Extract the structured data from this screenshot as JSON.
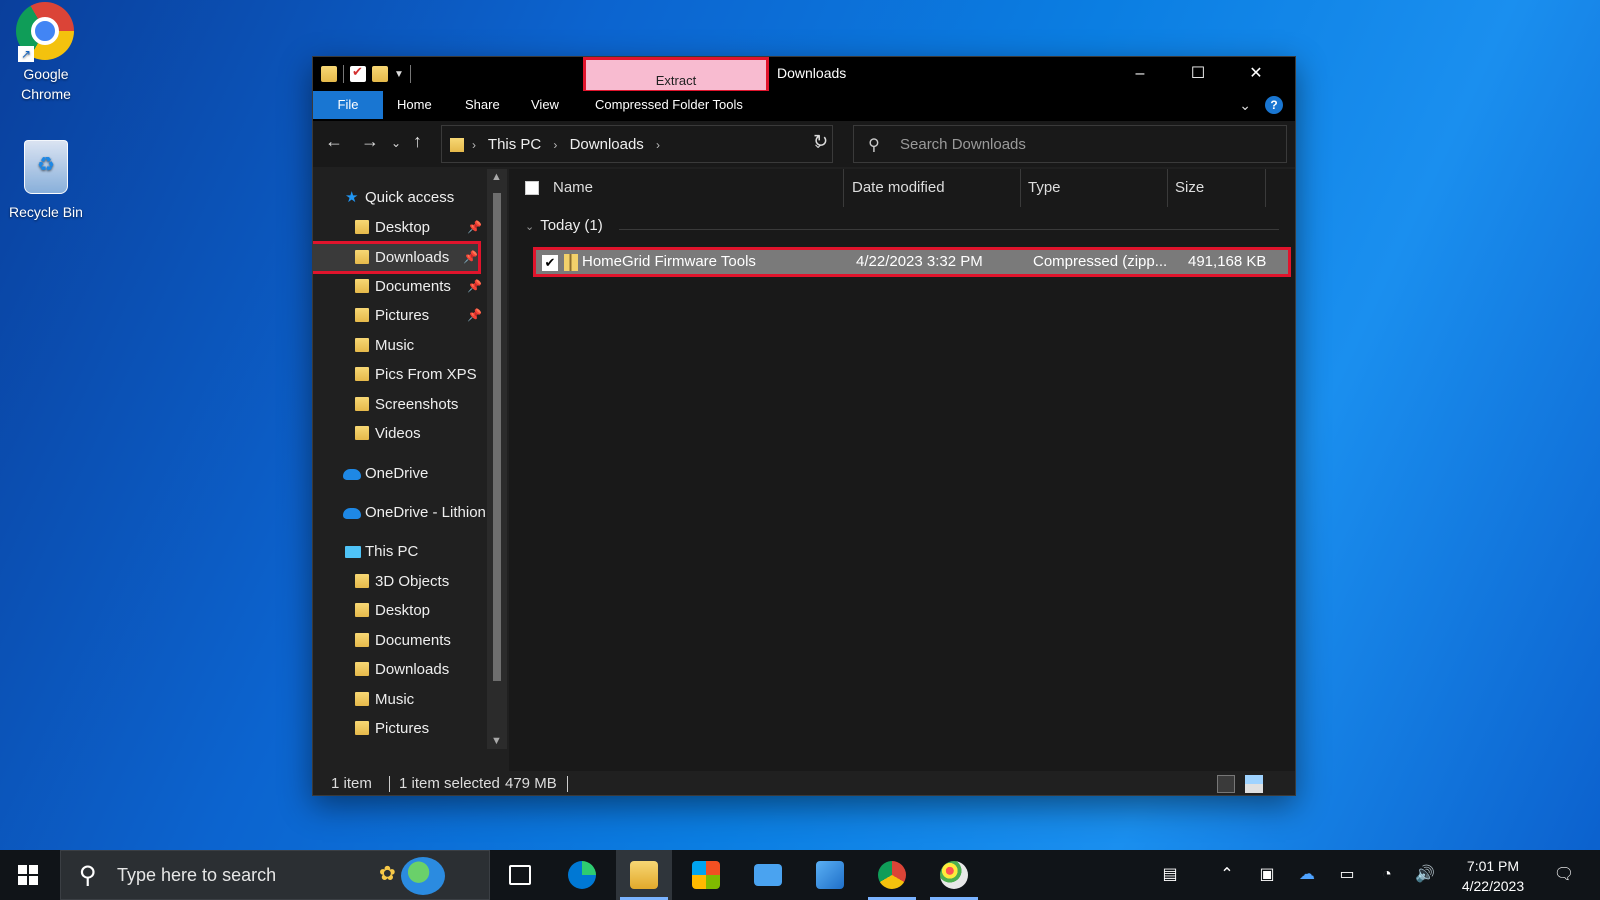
{
  "desktop": {
    "icons": [
      {
        "label_line1": "Google",
        "label_line2": "Chrome"
      },
      {
        "label_line1": "Recycle Bin",
        "label_line2": ""
      }
    ]
  },
  "window": {
    "title": "Downloads",
    "context_tab": "Extract",
    "controls": {
      "minimize": "–",
      "maximize": "☐",
      "close": "✕"
    },
    "ribbon_tabs": [
      "File",
      "Home",
      "Share",
      "View",
      "Compressed Folder Tools"
    ],
    "help": "?",
    "address": {
      "crumbs": [
        "This PC",
        "Downloads"
      ]
    },
    "search_placeholder": "Search Downloads"
  },
  "sidebar": {
    "quick_access": "Quick access",
    "quick_items": [
      {
        "label": "Desktop",
        "pinned": true
      },
      {
        "label": "Downloads",
        "pinned": true
      },
      {
        "label": "Documents",
        "pinned": true
      },
      {
        "label": "Pictures",
        "pinned": true
      },
      {
        "label": "Music",
        "pinned": false
      },
      {
        "label": "Pics From XPS",
        "pinned": false
      },
      {
        "label": "Screenshots",
        "pinned": false
      },
      {
        "label": "Videos",
        "pinned": false
      }
    ],
    "onedrive": "OneDrive",
    "onedrive_org": "OneDrive - Lithion",
    "this_pc": "This PC",
    "pc_items": [
      "3D Objects",
      "Desktop",
      "Documents",
      "Downloads",
      "Music",
      "Pictures"
    ]
  },
  "columns": {
    "name": "Name",
    "date": "Date modified",
    "type": "Type",
    "size": "Size"
  },
  "group": {
    "label": "Today (1)"
  },
  "files": [
    {
      "name": "HomeGrid Firmware Tools",
      "date": "4/22/2023 3:32 PM",
      "type": "Compressed (zipp...",
      "size": "491,168 KB",
      "selected": true
    }
  ],
  "status": {
    "count": "1 item",
    "selected": "1 item selected",
    "size": "479 MB"
  },
  "taskbar": {
    "search_placeholder": "Type here to search",
    "time": "7:01 PM",
    "date": "4/22/2023"
  },
  "colors": {
    "accent": "#1976d2",
    "highlight_border": "#e0142c",
    "context_tab_bg": "#f8bbd0"
  }
}
